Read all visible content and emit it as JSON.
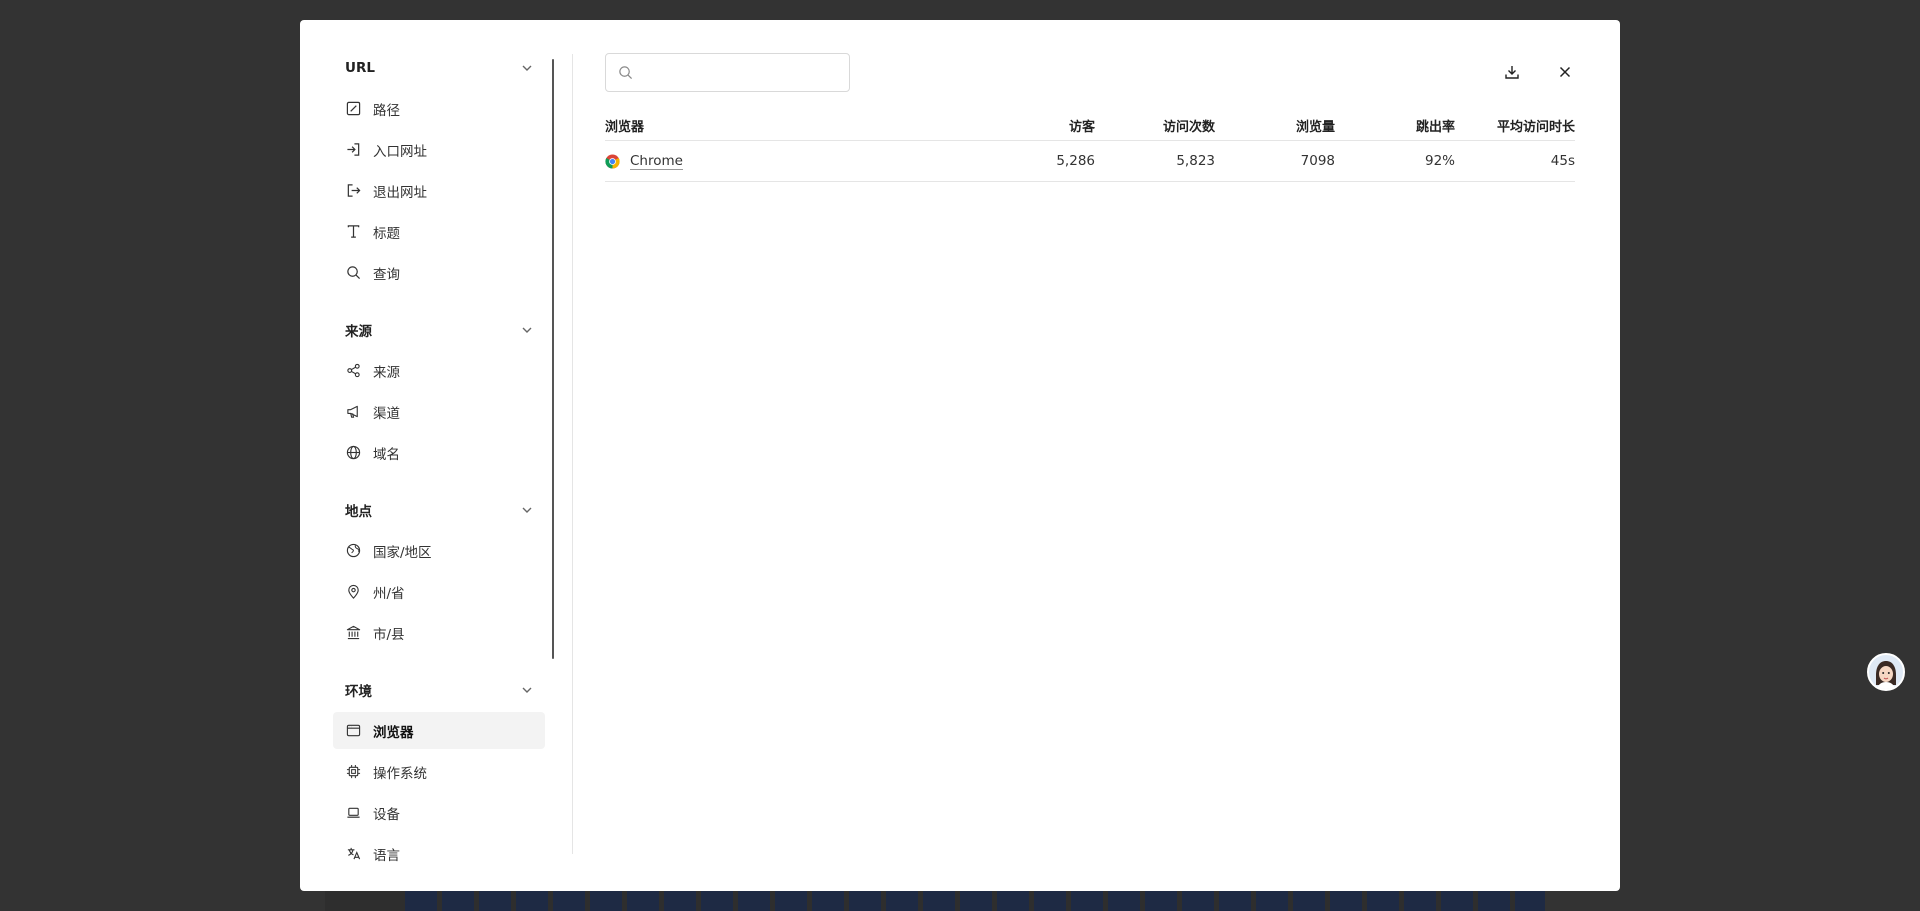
{
  "sidebar": {
    "sections": [
      {
        "title": "URL",
        "items": [
          {
            "label": "路径",
            "icon": "path-icon"
          },
          {
            "label": "入口网址",
            "icon": "entry-icon"
          },
          {
            "label": "退出网址",
            "icon": "exit-icon"
          },
          {
            "label": "标题",
            "icon": "title-icon"
          },
          {
            "label": "查询",
            "icon": "search-icon"
          }
        ]
      },
      {
        "title": "来源",
        "items": [
          {
            "label": "来源",
            "icon": "share-icon"
          },
          {
            "label": "渠道",
            "icon": "megaphone-icon"
          },
          {
            "label": "域名",
            "icon": "globe-icon"
          }
        ]
      },
      {
        "title": "地点",
        "items": [
          {
            "label": "国家/地区",
            "icon": "earth-icon"
          },
          {
            "label": "州/省",
            "icon": "map-pin-icon"
          },
          {
            "label": "市/县",
            "icon": "landmark-icon"
          }
        ]
      },
      {
        "title": "环境",
        "items": [
          {
            "label": "浏览器",
            "icon": "browser-window-icon",
            "active": true
          },
          {
            "label": "操作系统",
            "icon": "cpu-icon"
          },
          {
            "label": "设备",
            "icon": "laptop-icon"
          },
          {
            "label": "语言",
            "icon": "language-icon"
          }
        ]
      }
    ]
  },
  "search": {
    "value": "",
    "placeholder": ""
  },
  "table": {
    "headers": [
      "浏览器",
      "访客",
      "访问次数",
      "浏览量",
      "跳出率",
      "平均访问时长"
    ],
    "rows": [
      {
        "name": "Chrome",
        "icon": "chrome-icon",
        "visitors": "5,286",
        "visits": "5,823",
        "views": "7098",
        "bounce": "92%",
        "duration": "45s"
      }
    ]
  },
  "colors": {
    "overlay": "#333333",
    "modal": "#ffffff",
    "active_item": "#f3f3f3",
    "border": "#e5e5e5"
  }
}
